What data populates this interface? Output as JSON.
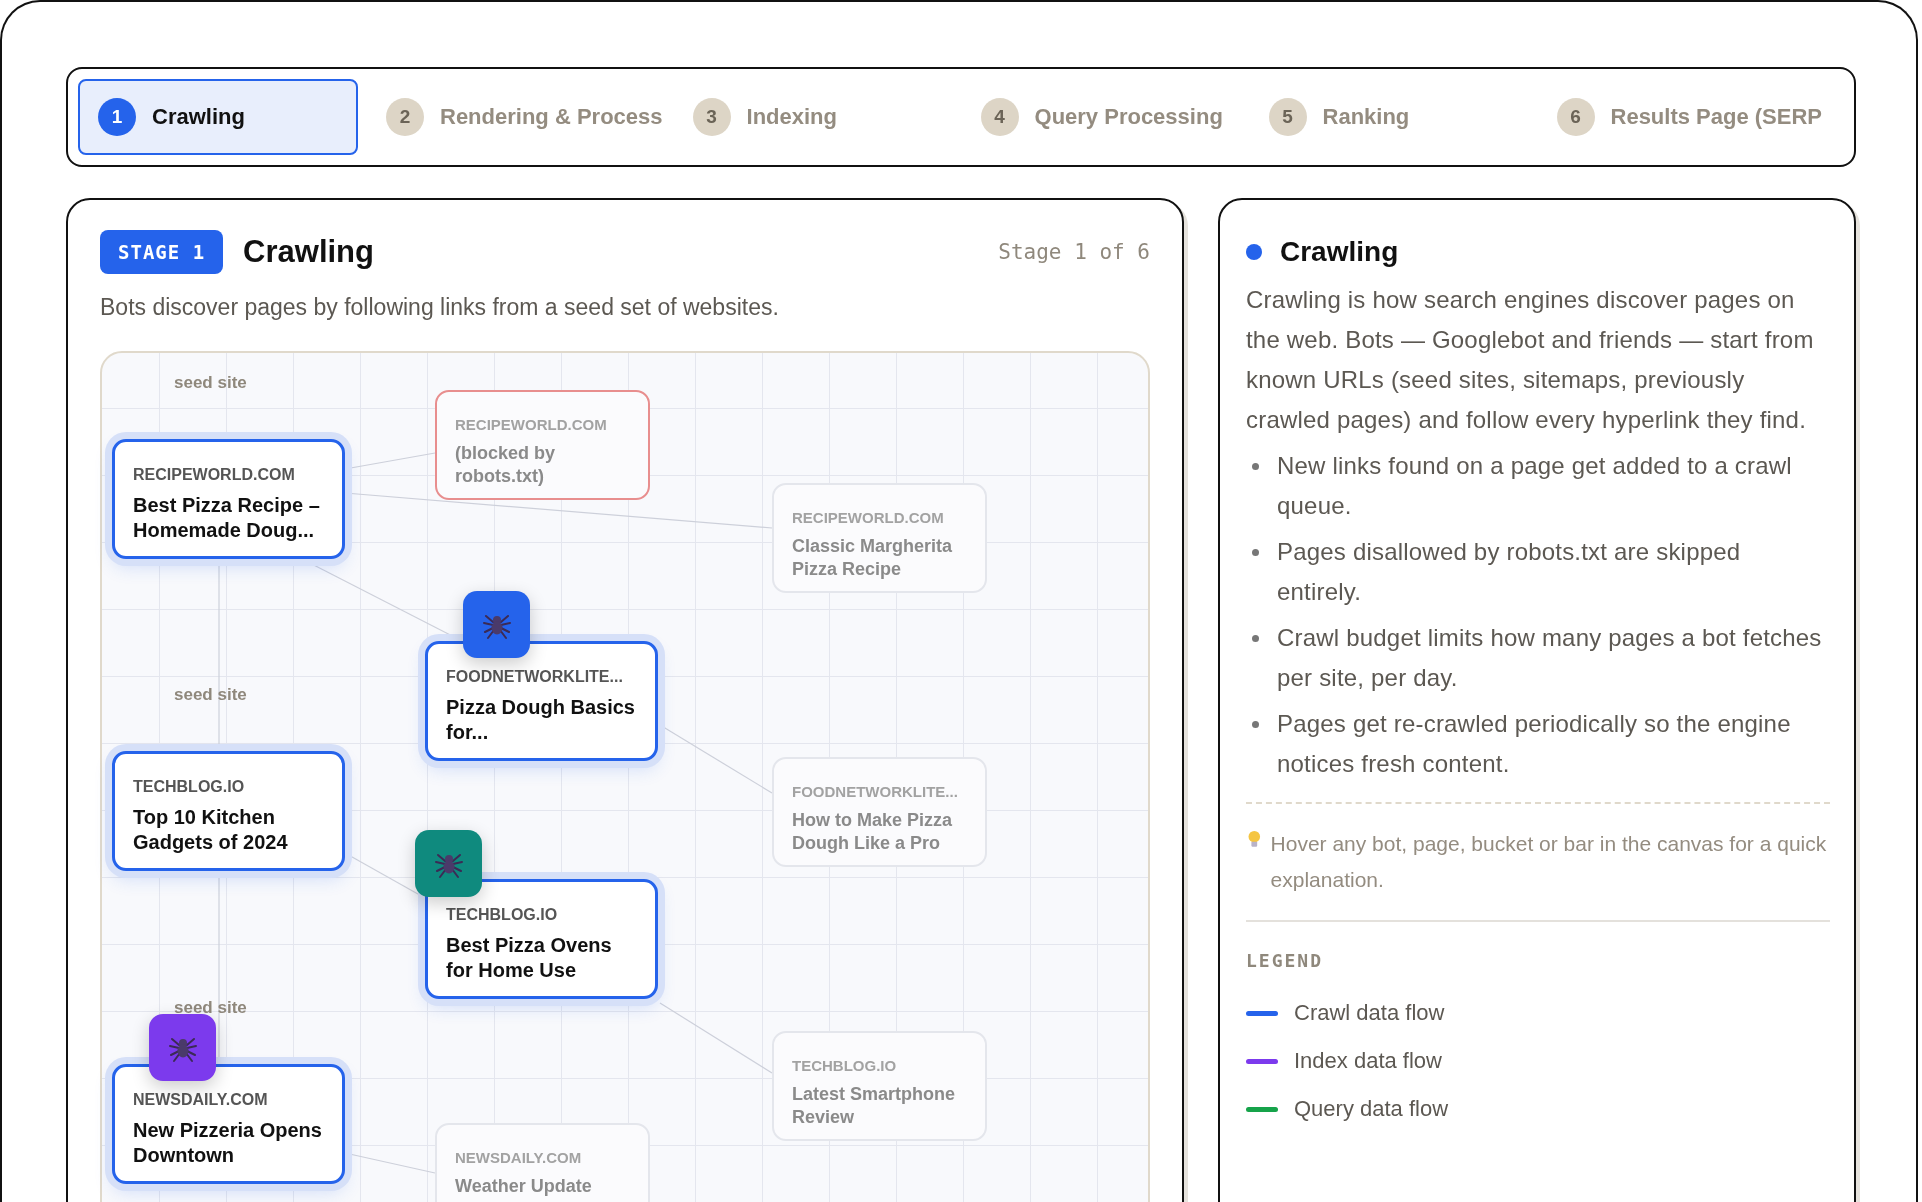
{
  "tabs": [
    {
      "number": "1",
      "label": "Crawling",
      "selected": true
    },
    {
      "number": "2",
      "label": "Rendering & Process",
      "selected": false
    },
    {
      "number": "3",
      "label": "Indexing",
      "selected": false
    },
    {
      "number": "4",
      "label": "Query Processing",
      "selected": false
    },
    {
      "number": "5",
      "label": "Ranking",
      "selected": false
    },
    {
      "number": "6",
      "label": "Results Page (SERP",
      "selected": false
    }
  ],
  "stage": {
    "badge": "STAGE 1",
    "title": "Crawling",
    "counter": "Stage 1 of 6",
    "description": "Bots discover pages by following links from a seed set of websites."
  },
  "canvas": {
    "nodes": [
      {
        "kind": "visited",
        "domain": "RECIPEWORLD.COM",
        "title": "Best Pizza Recipe – Homemade Doug...",
        "caption": "seed site"
      },
      {
        "kind": "blocked",
        "domain": "RECIPEWORLD.COM",
        "title": "(blocked by robots.txt)"
      },
      {
        "kind": "queued",
        "domain": "RECIPEWORLD.COM",
        "title": "Classic Margherita Pizza Recipe"
      },
      {
        "kind": "visited",
        "domain": "FOODNETWORKLITE...",
        "title": "Pizza Dough Basics for...",
        "bot": {
          "color": "#2563eb"
        }
      },
      {
        "kind": "visited",
        "domain": "TECHBLOG.IO",
        "title": "Top 10 Kitchen Gadgets of 2024",
        "caption": "seed site"
      },
      {
        "kind": "queued",
        "domain": "FOODNETWORKLITE...",
        "title": "How to Make Pizza Dough Like a Pro"
      },
      {
        "kind": "visited",
        "domain": "TECHBLOG.IO",
        "title": "Best Pizza Ovens for Home Use",
        "bot": {
          "color": "#0f8a7e"
        }
      },
      {
        "kind": "visited",
        "domain": "NEWSDAILY.COM",
        "title": "New Pizzeria Opens Downtown",
        "caption": "seed site",
        "bot": {
          "color": "#7c3aed"
        }
      },
      {
        "kind": "queued",
        "domain": "TECHBLOG.IO",
        "title": "Latest Smartphone Review"
      },
      {
        "kind": "queued",
        "domain": "NEWSDAILY.COM",
        "title": "Weather Update"
      }
    ]
  },
  "info": {
    "title": "Crawling",
    "paragraph": "Crawling is how search engines discover pages on the web. Bots — Googlebot and friends — start from known URLs (seed sites, sitemaps, previously crawled pages) and follow every hyperlink they find.",
    "bullets": [
      "New links found on a page get added to a crawl queue.",
      "Pages disallowed by robots.txt are skipped entirely.",
      "Crawl budget limits how many pages a bot fetches per site, per day.",
      "Pages get re-crawled periodically so the engine notices fresh content."
    ],
    "hint": "Hover any bot, page, bucket or bar in the canvas for a quick explanation.",
    "legend": {
      "title": "LEGEND",
      "items": [
        {
          "label": "Crawl data flow",
          "color": "#2563eb"
        },
        {
          "label": "Index data flow",
          "color": "#7c3aed"
        },
        {
          "label": "Query data flow",
          "color": "#16a34a"
        }
      ]
    }
  }
}
